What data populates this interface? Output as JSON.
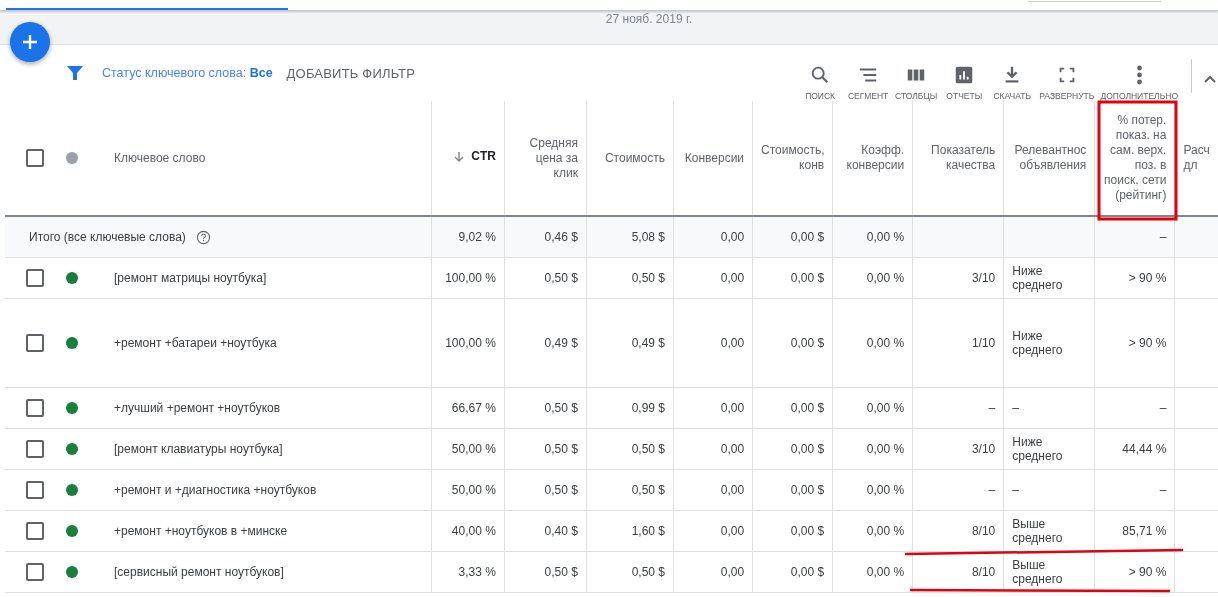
{
  "header": {
    "date": "27 нояб. 2019 г."
  },
  "filter": {
    "label": "Статус ключевого слова: **Все**",
    "add_filter": "ДОБАВИТЬ ФИЛЬТР"
  },
  "toolbar": [
    {
      "kind": "search",
      "label": "ПОИСК"
    },
    {
      "kind": "segment",
      "label": "СЕГМЕНТ"
    },
    {
      "kind": "columns",
      "label": "СТОЛБЦЫ"
    },
    {
      "kind": "reports",
      "label": "ОТЧЕТЫ"
    },
    {
      "kind": "download",
      "label": "СКАЧАТЬ"
    },
    {
      "kind": "expand",
      "label": "РАЗВЕРНУТЬ"
    },
    {
      "kind": "more",
      "label": "ДОПОЛНИТЕЛЬНО"
    }
  ],
  "table": {
    "header_checked": false,
    "keyword_column": "Ключевое слово",
    "columns": [
      {
        "label": "CTR",
        "sorted": true
      },
      {
        "label": "Средняя цена за клик",
        "sorted": false
      },
      {
        "label": "Стоимость",
        "sorted": false
      },
      {
        "label": "Конверсии",
        "sorted": false
      },
      {
        "label": "Стоимость, конв",
        "sorted": false
      },
      {
        "label": "Коэфф. конверсии",
        "sorted": false
      },
      {
        "label": "Показатель качества",
        "sorted": false
      },
      {
        "label": "Релевантнос объявления",
        "sorted": false
      },
      {
        "label": "% потер. показ. на сам. верх. поз. в поиск. сети (рейтинг)",
        "sorted": false
      },
      {
        "label": "Расч дл",
        "sorted": false
      }
    ],
    "total": {
      "label": "Итого (все ключевые слова)",
      "cells": [
        "9,02 %",
        "0,46 $",
        "5,08 $",
        "0,00",
        "0,00 $",
        "0,00 %",
        "",
        "",
        "–",
        ""
      ]
    },
    "rows": [
      {
        "keyword": "[ремонт матрицы ноутбука]",
        "checked": false,
        "tall": false,
        "cells": [
          "100,00 %",
          "0,50 $",
          "0,50 $",
          "0,00",
          "0,00 $",
          "0,00 %",
          "3/10",
          "Ниже среднего",
          "> 90 %",
          ""
        ]
      },
      {
        "keyword": "+ремонт +батареи +ноутбука",
        "checked": false,
        "tall": true,
        "cells": [
          "100,00 %",
          "0,49 $",
          "0,49 $",
          "0,00",
          "0,00 $",
          "0,00 %",
          "1/10",
          "Ниже среднего",
          "> 90 %",
          ""
        ]
      },
      {
        "keyword": "+лучший +ремонт +ноутбуков",
        "checked": false,
        "tall": false,
        "cells": [
          "66,67 %",
          "0,50 $",
          "0,99 $",
          "0,00",
          "0,00 $",
          "0,00 %",
          "–",
          "–",
          "–",
          ""
        ]
      },
      {
        "keyword": "[ремонт клавиатуры ноутбука]",
        "checked": false,
        "tall": false,
        "cells": [
          "50,00 %",
          "0,50 $",
          "0,50 $",
          "0,00",
          "0,00 $",
          "0,00 %",
          "3/10",
          "Ниже среднего",
          "44,44 %",
          ""
        ]
      },
      {
        "keyword": "+ремонт и +диагностика +ноутбуков",
        "checked": false,
        "tall": false,
        "cells": [
          "50,00 %",
          "0,50 $",
          "0,50 $",
          "0,00",
          "0,00 $",
          "0,00 %",
          "–",
          "–",
          "–",
          ""
        ]
      },
      {
        "keyword": "+ремонт +ноутбуков в +минске",
        "checked": false,
        "tall": false,
        "cells": [
          "40,00 %",
          "0,40 $",
          "1,60 $",
          "0,00",
          "0,00 $",
          "0,00 %",
          "8/10",
          "Выше среднего",
          "85,71 %",
          ""
        ]
      },
      {
        "keyword": "[сервисный ремонт ноутбуков]",
        "checked": false,
        "tall": false,
        "cells": [
          "3,33 %",
          "0,50 $",
          "0,50 $",
          "0,00",
          "0,00 $",
          "0,00 %",
          "8/10",
          "Выше среднего",
          "> 90 %",
          ""
        ]
      }
    ]
  }
}
